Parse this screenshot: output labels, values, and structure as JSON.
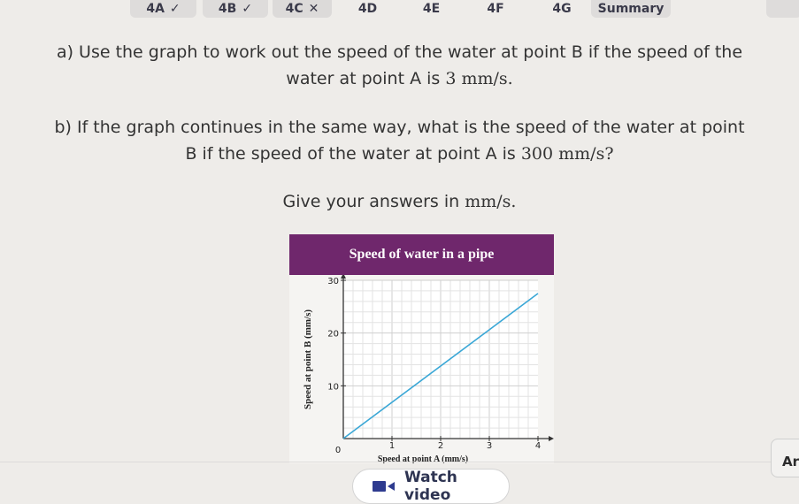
{
  "tabs": [
    {
      "label": "4A",
      "mark": "✓",
      "state": "done"
    },
    {
      "label": "4B",
      "mark": "✓",
      "state": "done"
    },
    {
      "label": "4C",
      "mark": "✕",
      "state": "current"
    },
    {
      "label": "4D",
      "mark": "",
      "state": "none"
    },
    {
      "label": "4E",
      "mark": "",
      "state": "none"
    },
    {
      "label": "4F",
      "mark": "",
      "state": "none"
    },
    {
      "label": "4G",
      "mark": "",
      "state": "none"
    },
    {
      "label": "Summary",
      "mark": "",
      "state": "none"
    }
  ],
  "question": {
    "a_line1": "a) Use the graph to work out the speed of the water at point B if the speed of the",
    "a_line2_pre": "water at point A is ",
    "a_line2_math": "3 mm/s.",
    "b_line1": "b) If the graph continues in the same way, what is the speed of the water at point",
    "b_line2_pre": "B if the speed of the water at point A is ",
    "b_line2_math": "300 mm/s?",
    "units_pre": "Give your answers in ",
    "units_math": "mm/s."
  },
  "chart_data": {
    "type": "line",
    "title": "Speed of water in a pipe",
    "xlabel": "Speed at point A (mm/s)",
    "ylabel": "Speed at point B (mm/s)",
    "xlim": [
      0,
      4
    ],
    "ylim": [
      0,
      30
    ],
    "xticks": [
      0,
      1,
      2,
      3,
      4
    ],
    "yticks": [
      10,
      20,
      30
    ],
    "grid": true,
    "series": [
      {
        "x": [
          0,
          4
        ],
        "y": [
          0,
          27.5
        ],
        "color": "#3aa7d6"
      }
    ]
  },
  "answer_tab": "Ar",
  "watch_video": "Watch video",
  "colors": {
    "chart_header": "#6f276c",
    "line": "#3aa7d6",
    "video_icon": "#2e3b8f"
  }
}
